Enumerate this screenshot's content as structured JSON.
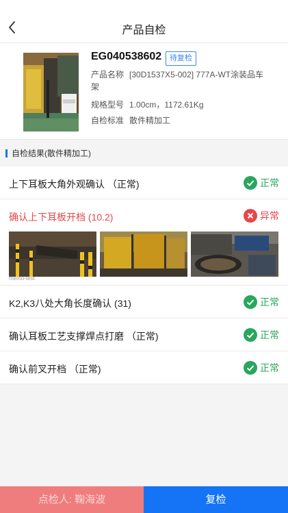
{
  "nav": {
    "title": "产品自检"
  },
  "product": {
    "code": "EG040538602",
    "status_tag": "待复检",
    "name_label": "产品名称",
    "name_value": "[30D1537X5-002] 777A-WT涂装品车架",
    "spec_label": "规格型号",
    "spec_value": "1.00cm，1172.61Kg",
    "std_label": "自检标准",
    "std_value": "散件精加工"
  },
  "section": {
    "title": "自检结果(散件精加工)"
  },
  "checks": [
    {
      "title": "上下耳板大角外观确认 （正常)",
      "status": "正常",
      "status_type": "ok"
    },
    {
      "title": "确认上下耳板开档 (10.2)",
      "status": "异常",
      "status_type": "abnormal",
      "photo_watermark": "memo-test"
    },
    {
      "title": "K2,K3八处大角长度确认 (31)",
      "status": "正常",
      "status_type": "ok"
    },
    {
      "title": "确认耳板工艺支撑焊点打磨 （正常)",
      "status": "正常",
      "status_type": "ok"
    },
    {
      "title": "确认前叉开档 （正常)",
      "status": "正常",
      "status_type": "ok"
    }
  ],
  "footer": {
    "inspector_label": "点检人: 鞠海波",
    "recheck_label": "复检"
  },
  "colors": {
    "accent": "#1474f5",
    "ok": "#2aa65e",
    "abnormal": "#e54848",
    "inspector_bg": "#f07d7d"
  },
  "icons": {
    "back": "chevron-left-icon",
    "ok": "check-circle-icon",
    "abnormal": "x-circle-icon"
  }
}
